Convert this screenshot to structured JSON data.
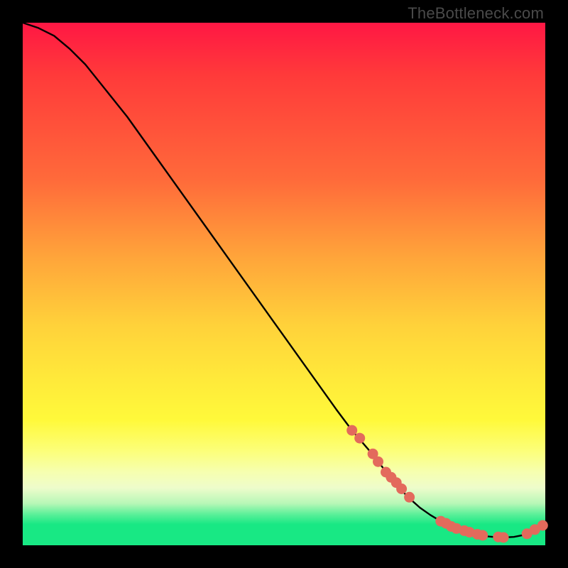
{
  "watermark": "TheBottleneck.com",
  "chart_data": {
    "type": "line",
    "title": "",
    "xlabel": "",
    "ylabel": "",
    "xlim": [
      0,
      100
    ],
    "ylim": [
      0,
      100
    ],
    "grid": false,
    "legend": false,
    "series": [
      {
        "name": "curve",
        "color": "#000000",
        "x": [
          0,
          3,
          6,
          9,
          12,
          16,
          20,
          25,
          30,
          35,
          40,
          45,
          50,
          55,
          60,
          63,
          66,
          68,
          70,
          72,
          74,
          76,
          78,
          80,
          82,
          84,
          86,
          88,
          90,
          92,
          94,
          96,
          98,
          100
        ],
        "y": [
          100,
          99,
          97.5,
          95,
          92,
          87,
          82,
          75,
          68,
          61,
          54,
          47,
          40,
          33,
          26,
          22,
          18.5,
          16,
          13.5,
          11,
          9,
          7.2,
          5.8,
          4.6,
          3.6,
          2.8,
          2.2,
          1.8,
          1.6,
          1.5,
          1.6,
          2.0,
          2.8,
          4.0
        ]
      },
      {
        "name": "marker-cluster",
        "color": "#e36a5c",
        "type": "scatter",
        "x": [
          63,
          64.5,
          67,
          68,
          69.5,
          70.5,
          71.5,
          72.5,
          74,
          80,
          81,
          82,
          83,
          84.5,
          85.5,
          87,
          88,
          91,
          92,
          96.5,
          98,
          99.5
        ],
        "y": [
          22,
          20.5,
          17.5,
          16,
          14,
          13,
          12,
          10.8,
          9.2,
          4.6,
          4.2,
          3.6,
          3.2,
          2.8,
          2.5,
          2.1,
          1.9,
          1.6,
          1.5,
          2.2,
          3.0,
          3.8
        ]
      }
    ]
  },
  "colors": {
    "marker": "#e36a5c",
    "curve": "#000000"
  }
}
